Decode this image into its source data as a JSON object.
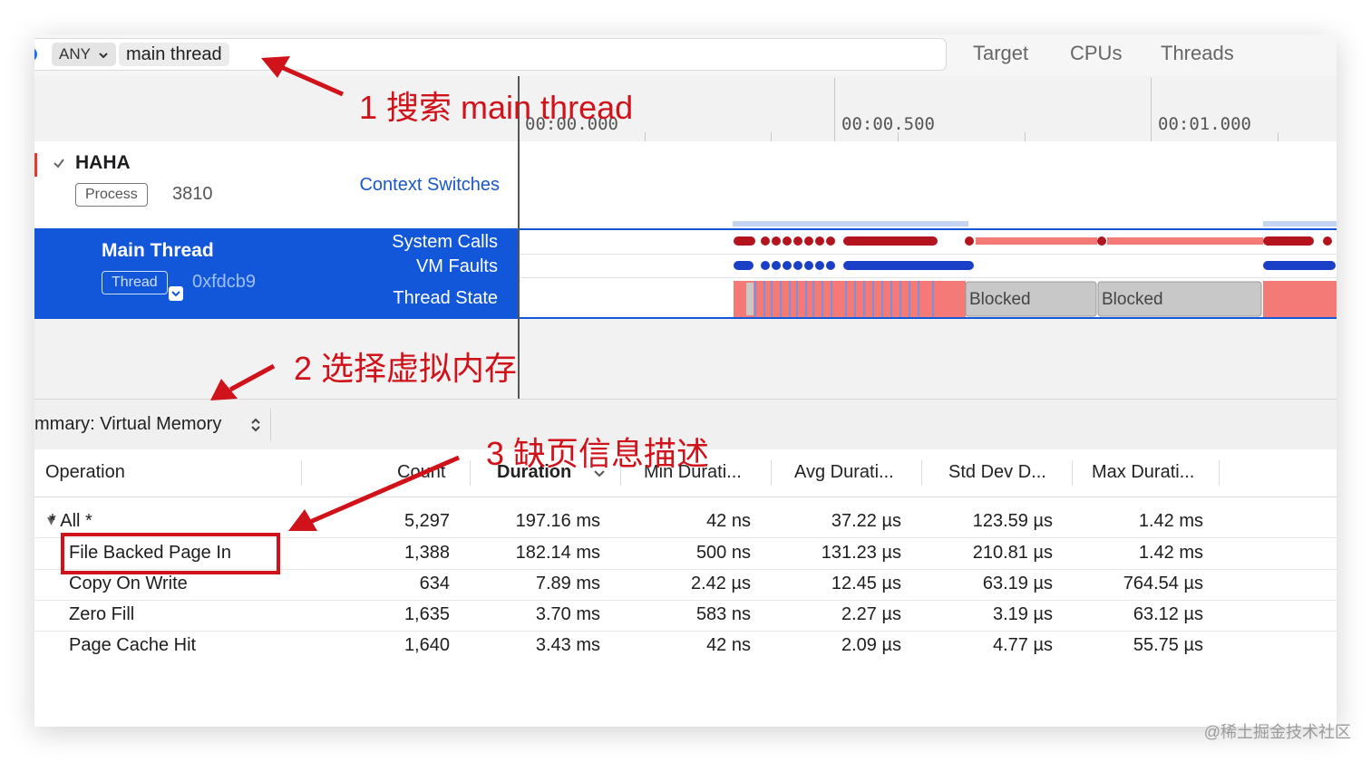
{
  "filter_bar": {
    "scope_label": "ANY",
    "search_token": "main thread",
    "nav": [
      "Target",
      "CPUs",
      "Threads"
    ]
  },
  "ruler": {
    "labels": [
      "00:00.000",
      "00:00.500",
      "00:01.000"
    ]
  },
  "process": {
    "name": "HAHA",
    "type_badge": "Process",
    "pid": "3810",
    "track_label": "Context Switches"
  },
  "thread": {
    "name": "Main Thread",
    "type_badge": "Thread",
    "tid": "0xfdcb9",
    "tracks": [
      "System Calls",
      "VM Faults",
      "Thread State"
    ],
    "states": [
      "Blocked",
      "Blocked"
    ]
  },
  "summary": {
    "label": "mmary: Virtual Memory"
  },
  "table": {
    "headers": [
      "Operation",
      "Count",
      "Duration",
      "Min Durati...",
      "Avg Durati...",
      "Std Dev D...",
      "Max Durati..."
    ],
    "rows": [
      {
        "op": "* All *",
        "count": "5,297",
        "duration": "197.16 ms",
        "min": "42 ns",
        "avg": "37.22 µs",
        "std": "123.59 µs",
        "max": "1.42 ms"
      },
      {
        "op": "File Backed Page In",
        "count": "1,388",
        "duration": "182.14 ms",
        "min": "500 ns",
        "avg": "131.23 µs",
        "std": "210.81 µs",
        "max": "1.42 ms"
      },
      {
        "op": "Copy On Write",
        "count": "634",
        "duration": "7.89 ms",
        "min": "2.42 µs",
        "avg": "12.45 µs",
        "std": "63.19 µs",
        "max": "764.54 µs"
      },
      {
        "op": "Zero Fill",
        "count": "1,635",
        "duration": "3.70 ms",
        "min": "583 ns",
        "avg": "2.27 µs",
        "std": "3.19 µs",
        "max": "63.12 µs"
      },
      {
        "op": "Page Cache Hit",
        "count": "1,640",
        "duration": "3.43 ms",
        "min": "42 ns",
        "avg": "2.09 µs",
        "std": "4.77 µs",
        "max": "55.75 µs"
      }
    ]
  },
  "annotations": {
    "step1": "1 搜索 main thread",
    "step2": "2 选择虚拟内存",
    "step3": "3 缺页信息描述"
  },
  "watermark": "@稀土掘金技术社区",
  "colors": {
    "selection_blue": "#1257d9",
    "annotation_red": "#d0121b",
    "syscall_red": "#b4141e",
    "state_pink": "#f47a78",
    "fault_blue": "#1a40c8",
    "blocked_gray": "#c8c8c8"
  },
  "icons": [
    "scope-icon",
    "chevron-down-icon",
    "checkmark-icon",
    "updown-chevron-icon",
    "sort-chevron-icon"
  ]
}
